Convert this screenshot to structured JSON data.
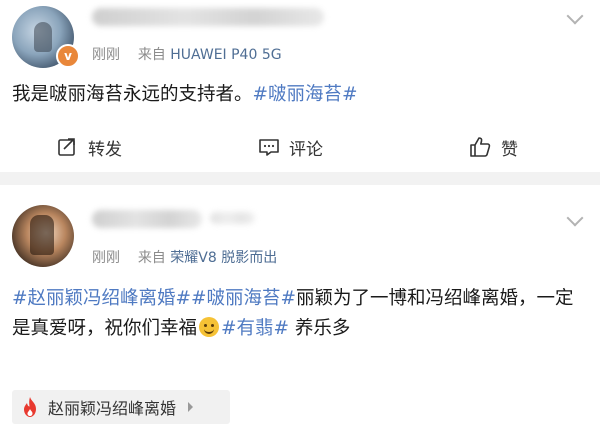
{
  "post1": {
    "time": "刚刚",
    "source_prefix": "来自",
    "source": "HUAWEI P40 5G",
    "verified_badge": "v",
    "text": "我是啵丽海苔永远的支持者。",
    "tag": "#啵丽海苔#",
    "actions": {
      "share": "转发",
      "comment": "评论",
      "like": "赞"
    }
  },
  "post2": {
    "time": "刚刚",
    "source_prefix": "来自",
    "source": "荣耀V8 脱影而出",
    "tag1": "#赵丽颖冯绍峰离婚#",
    "tag2": "#啵丽海苔#",
    "text1": "丽颖为了一博和冯绍峰离婚，一定是真爱呀，祝你们幸福",
    "tag3": "#有翡#",
    "text2": " 养乐多",
    "topic": "赵丽颖冯绍峰离婚"
  },
  "colors": {
    "link": "#4f7ac2",
    "meta": "#8c8c8c",
    "separator": "#f2f2f2",
    "fire": "#e8392f"
  },
  "icons": [
    "share-icon",
    "comment-icon",
    "like-icon",
    "fire-icon",
    "chevron-down-icon",
    "verified-badge"
  ]
}
